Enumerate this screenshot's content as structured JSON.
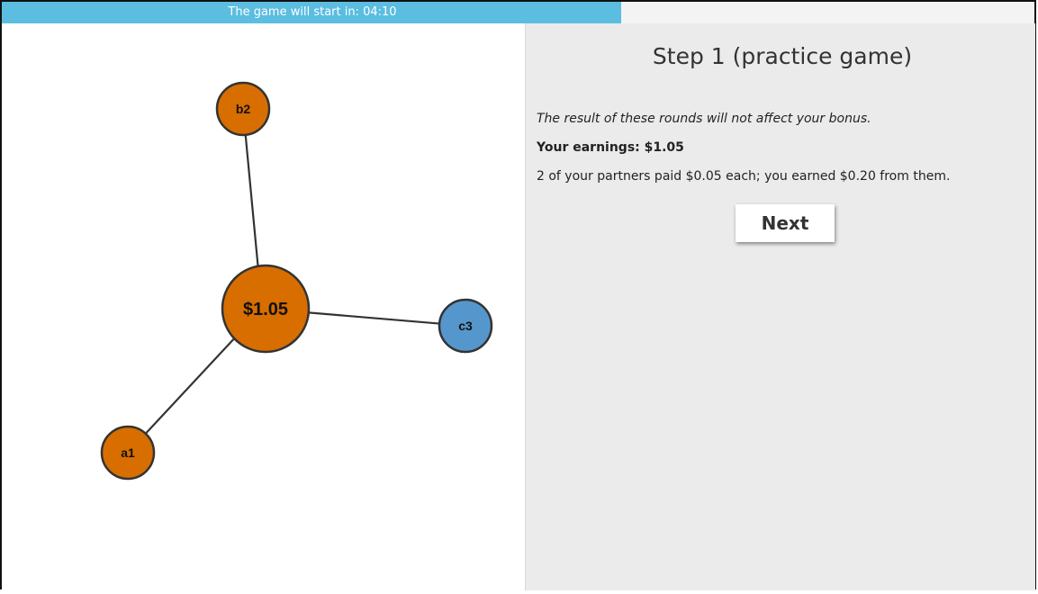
{
  "timer": {
    "label": "The game will start in: 04:10",
    "fill_fraction": 0.6,
    "color": "#5bbde0"
  },
  "graph": {
    "center_node": {
      "label": "$1.05",
      "color": "#d86e00"
    },
    "nodes": [
      {
        "id": "b2",
        "label": "b2",
        "color": "#d86e00"
      },
      {
        "id": "c3",
        "label": "c3",
        "color": "#5597cc"
      },
      {
        "id": "a1",
        "label": "a1",
        "color": "#d86e00"
      }
    ]
  },
  "panel": {
    "title": "Step 1 (practice game)",
    "note": "The result of these rounds will not affect your bonus.",
    "earnings": "Your earnings: $1.05",
    "partners_text": "2 of your partners paid $0.05 each; you earned $0.20 from them.",
    "next_label": "Next"
  }
}
